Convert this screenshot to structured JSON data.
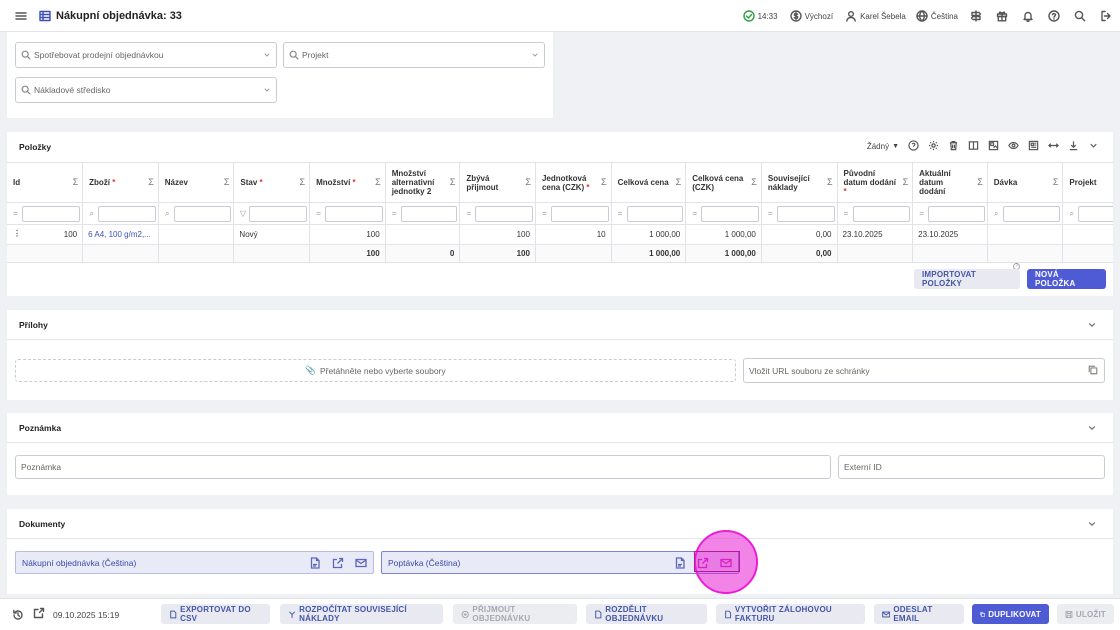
{
  "header": {
    "title": "Nákupní objednávka: 33",
    "time": "14:33",
    "currency": "Výchozí",
    "user": "Karel Šebela",
    "language": "Čeština"
  },
  "top_filters": {
    "consume_sales_order": "Spotřebovat prodejní objednávkou",
    "project": "Projekt",
    "cost_center": "Nákladové středisko"
  },
  "items": {
    "title": "Položky",
    "view_select": "Žádný",
    "sigma": "Σ",
    "columns": [
      {
        "label": "Id",
        "required": false
      },
      {
        "label": "Zboží",
        "required": true
      },
      {
        "label": "Název",
        "required": false
      },
      {
        "label": "Stav",
        "required": true
      },
      {
        "label": "Množství",
        "required": true
      },
      {
        "label": "Množství alternativní jednotky 2",
        "required": false
      },
      {
        "label": "Zbývá přijmout",
        "required": false
      },
      {
        "label": "Jednotková cena (CZK)",
        "required": true
      },
      {
        "label": "Celková cena",
        "required": false
      },
      {
        "label": "Celková cena (CZK)",
        "required": false
      },
      {
        "label": "Související náklady",
        "required": false
      },
      {
        "label": "Původní datum dodání",
        "required": true
      },
      {
        "label": "Aktuální datum dodání",
        "required": false
      },
      {
        "label": "Dávka",
        "required": false
      },
      {
        "label": "Projekt",
        "required": false
      }
    ],
    "row": {
      "id": "100",
      "goods": "6 A4, 100 g/m2,...",
      "name": "",
      "state": "Nový",
      "quantity": "100",
      "alt_qty": "",
      "remaining": "100",
      "unit_price": "10",
      "total": "1 000,00",
      "total_czk": "1 000,00",
      "related_costs": "0,00",
      "orig_date": "23.10.2025",
      "current_date": "23.10.2025",
      "batch": "",
      "project": ""
    },
    "sum": {
      "quantity": "100",
      "alt_qty": "0",
      "remaining": "100",
      "total": "1 000,00",
      "total_czk": "1 000,00",
      "related_costs": "0,00"
    },
    "import_button": "IMPORTOVAT POLOŽKY",
    "new_button": "NOVÁ POLOŽKA"
  },
  "attachments": {
    "title": "Přílohy",
    "drop_text": "Přetáhněte nebo vyberte soubory",
    "url_placeholder": "Vložit URL souboru ze schránky"
  },
  "note": {
    "title": "Poznámka",
    "note_placeholder": "Poznámka",
    "external_id_placeholder": "Externí ID"
  },
  "documents": {
    "title": "Dokumenty",
    "doc1": "Nákupní objednávka (Čeština)",
    "doc2": "Poptávka (Čeština)"
  },
  "footer": {
    "timestamp": "09.10.2025 15:19",
    "export_csv": "EXPORTOVAT DO CSV",
    "calc_costs": "ROZPOČÍTAT SOUVISEJÍCÍ NÁKLADY",
    "receive": "PŘIJMOUT OBJEDNÁVKU",
    "split": "ROZDĚLIT OBJEDNÁVKU",
    "advance_invoice": "VYTVOŘIT ZÁLOHOVOU FAKTURU",
    "send_email": "ODESLAT EMAIL",
    "duplicate": "DUPLIKOVAT",
    "save": "ULOŽIT"
  },
  "colors": {
    "accent": "#4f5bd5",
    "link": "#3b4fb8",
    "highlight": "#e81fd6"
  }
}
